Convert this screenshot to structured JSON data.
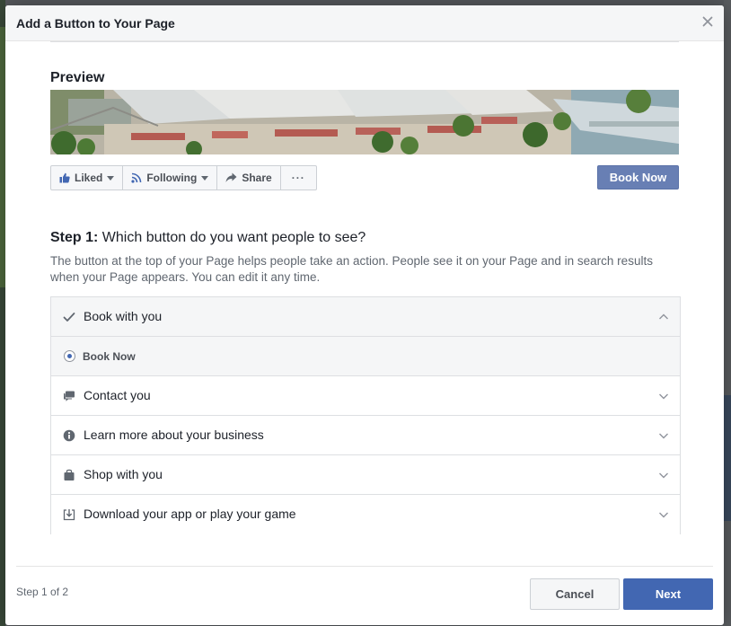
{
  "dialog": {
    "title": "Add a Button to Your Page",
    "close_icon": "close-icon"
  },
  "preview": {
    "label": "Preview",
    "page_actions": [
      {
        "label": "Liked",
        "icon": "thumbs-up-icon",
        "has_caret": true
      },
      {
        "label": "Following",
        "icon": "rss-icon",
        "has_caret": true
      },
      {
        "label": "Share",
        "icon": "share-arrow-icon",
        "has_caret": false
      },
      {
        "label": "···",
        "icon": "",
        "has_caret": false
      }
    ],
    "cta_button": "Book Now"
  },
  "step": {
    "prefix": "Step 1:",
    "question": "Which button do you want people to see?",
    "description": "The button at the top of your Page helps people take an action. People see it on your Page and in search results when your Page appears. You can edit it any time."
  },
  "options": [
    {
      "label": "Book with you",
      "icon": "checkmark-icon",
      "expanded": true
    },
    {
      "label": "Book Now",
      "icon": "radio-selected",
      "sub_option": true,
      "selected": true
    },
    {
      "label": "Contact you",
      "icon": "speech-bubble-icon",
      "expanded": false
    },
    {
      "label": "Learn more about your business",
      "icon": "info-icon",
      "expanded": false
    },
    {
      "label": "Shop with you",
      "icon": "shopping-bag-icon",
      "expanded": false
    },
    {
      "label": "Download your app or play your game",
      "icon": "download-icon",
      "expanded": false
    }
  ],
  "footer": {
    "step_count": "Step 1 of 2",
    "cancel_label": "Cancel",
    "next_label": "Next"
  },
  "colors": {
    "primary": "#4267b2",
    "cta_preview": "#687fb4",
    "header_bg": "#f5f6f7"
  }
}
